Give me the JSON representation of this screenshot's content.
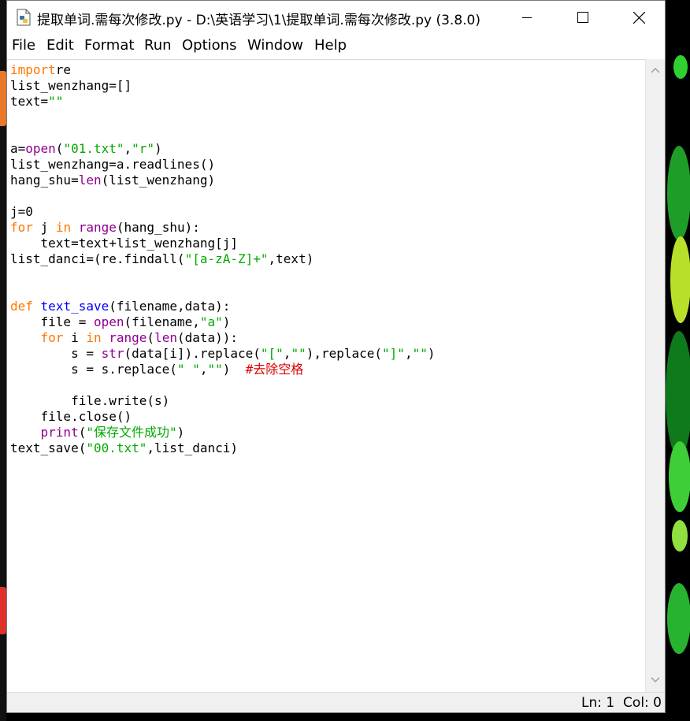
{
  "window": {
    "title": "提取单词.需每次修改.py - D:\\英语学习\\1\\提取单词.需每次修改.py (3.8.0)"
  },
  "menu": [
    "File",
    "Edit",
    "Format",
    "Run",
    "Options",
    "Window",
    "Help"
  ],
  "code_lines": [
    [
      [
        "kw",
        "import"
      ],
      [
        "",
        "re"
      ]
    ],
    [
      [
        "",
        "list_wenzhang=[]"
      ]
    ],
    [
      [
        "",
        "text="
      ],
      [
        "st",
        "\"\""
      ]
    ],
    [],
    [],
    [
      [
        "",
        "a="
      ],
      [
        "bi",
        "open"
      ],
      [
        "",
        "("
      ],
      [
        "st",
        "\"01.txt\""
      ],
      [
        "",
        ","
      ],
      [
        "st",
        "\"r\""
      ],
      [
        "",
        ")"
      ]
    ],
    [
      [
        "",
        "list_wenzhang=a.readlines()"
      ]
    ],
    [
      [
        "",
        "hang_shu="
      ],
      [
        "bi",
        "len"
      ],
      [
        "",
        "(list_wenzhang)"
      ]
    ],
    [],
    [
      [
        "",
        "j=0"
      ]
    ],
    [
      [
        "kw",
        "for"
      ],
      [
        "",
        " j "
      ],
      [
        "kw",
        "in"
      ],
      [
        "",
        " "
      ],
      [
        "bi",
        "range"
      ],
      [
        "",
        "(hang_shu):"
      ]
    ],
    [
      [
        "",
        "    text=text+list_wenzhang[j]"
      ]
    ],
    [
      [
        "",
        "list_danci=(re.findall("
      ],
      [
        "st",
        "\"[a-zA-Z]+\""
      ],
      [
        "",
        ",text)"
      ]
    ],
    [],
    [],
    [
      [
        "kw",
        "def"
      ],
      [
        "",
        " "
      ],
      [
        "df",
        "text_save"
      ],
      [
        "",
        "(filename,data):"
      ]
    ],
    [
      [
        "",
        "    file = "
      ],
      [
        "bi",
        "open"
      ],
      [
        "",
        "(filename,"
      ],
      [
        "st",
        "\"a\""
      ],
      [
        "",
        ")"
      ]
    ],
    [
      [
        "",
        "    "
      ],
      [
        "kw",
        "for"
      ],
      [
        "",
        " i "
      ],
      [
        "kw",
        "in"
      ],
      [
        "",
        " "
      ],
      [
        "bi",
        "range"
      ],
      [
        "",
        "("
      ],
      [
        "bi",
        "len"
      ],
      [
        "",
        "(data)):"
      ]
    ],
    [
      [
        "",
        "        s = "
      ],
      [
        "bi",
        "str"
      ],
      [
        "",
        "(data[i]).replace("
      ],
      [
        "st",
        "\"[\""
      ],
      [
        "",
        ","
      ],
      [
        "st",
        "\"\""
      ],
      [
        "",
        "),replace("
      ],
      [
        "st",
        "\"]\""
      ],
      [
        "",
        ","
      ],
      [
        "st",
        "\"\""
      ],
      [
        "",
        ")"
      ]
    ],
    [
      [
        "",
        "        s = s.replace("
      ],
      [
        "st",
        "\" \""
      ],
      [
        "",
        ","
      ],
      [
        "st",
        "\"\""
      ],
      [
        "",
        ")  "
      ],
      [
        "cm",
        "#去除空格"
      ]
    ],
    [],
    [
      [
        "",
        "        file.write(s)"
      ]
    ],
    [
      [
        "",
        "    file.close()"
      ]
    ],
    [
      [
        "",
        "    "
      ],
      [
        "bi",
        "print"
      ],
      [
        "",
        "("
      ],
      [
        "st",
        "\"保存文件成功\""
      ],
      [
        "",
        ")"
      ]
    ],
    [
      [
        "",
        "text_save("
      ],
      [
        "st",
        "\"00.txt\""
      ],
      [
        "",
        ",list_danci)"
      ]
    ]
  ],
  "status": {
    "position": "Ln: 1  Col: 0"
  },
  "colors": {
    "keyword": "#ff7700",
    "builtin": "#900090",
    "string": "#00aa00",
    "definition": "#0000ff",
    "comment": "#dd0000"
  }
}
